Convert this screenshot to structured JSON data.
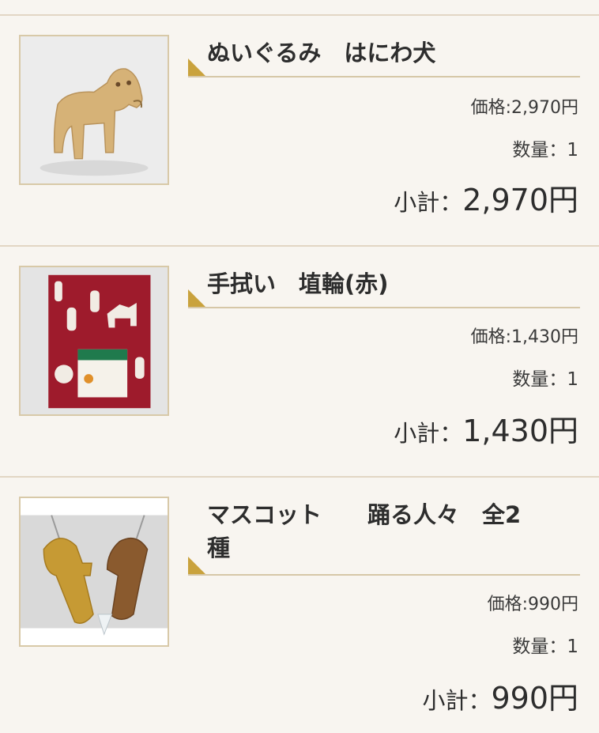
{
  "cart": {
    "items": [
      {
        "name": "ぬいぐるみ　はにわ犬",
        "price_text": "価格:2,970円",
        "qty_text": "数量：1",
        "subtotal_label": "小計：",
        "subtotal_value": "2,970円",
        "image": "haniwa-dog-plush-photo"
      },
      {
        "name": "手拭い　埴輪(赤)",
        "price_text": "価格:1,430円",
        "qty_text": "数量：1",
        "subtotal_label": "小計：",
        "subtotal_value": "1,430円",
        "image": "red-haniwa-tenugui-photo"
      },
      {
        "name": "マスコット　　踊る人々　全2\n種",
        "price_text": "価格:990円",
        "qty_text": "数量：1",
        "subtotal_label": "小計：",
        "subtotal_value": "990円",
        "image": "dancing-figures-mascot-photo"
      }
    ]
  },
  "colors": {
    "background": "#f8f5f0",
    "divider": "#e2d6c4",
    "accent_marker": "#c9a23d",
    "thumb_border": "#d8c9a8"
  }
}
